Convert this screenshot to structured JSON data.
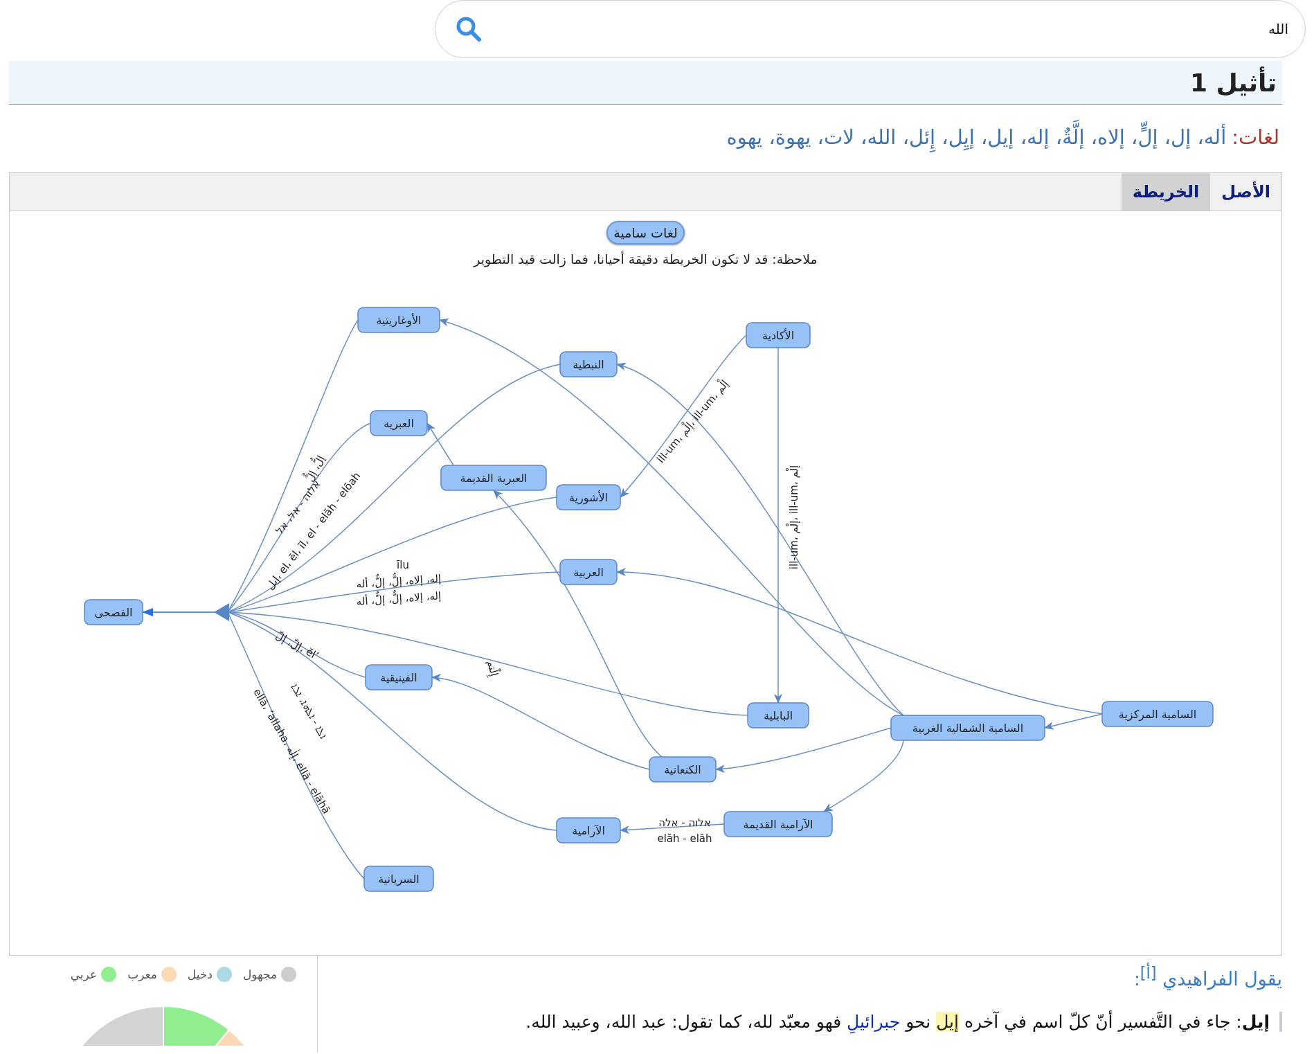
{
  "search": {
    "value": "الله"
  },
  "heading": "تأثيل 1",
  "languages_line": {
    "label": "لغات:",
    "value": "أله، إل، إلٍّ، إلاه، إلَّةٌ، إله، إيل، إيِل، إِئل، الله، لات، يهوة، يهوه"
  },
  "tabs": [
    {
      "label": "الأصل",
      "selected": false
    },
    {
      "label": "الخريطة",
      "selected": true
    }
  ],
  "map": {
    "title_button": "لغات سامية",
    "note": "ملاحظة: قد لا تكون الخريطة دقيقة أحيانا، فما زالت قيد التطوير",
    "nodes": [
      {
        "kind": "language",
        "label": "الفصحى"
      },
      {
        "kind": "language",
        "label": "الأوغاريتية"
      },
      {
        "kind": "language",
        "label": "العبرية"
      },
      {
        "kind": "language",
        "label": "العبرية القديمة"
      },
      {
        "kind": "language",
        "label": "النبطية"
      },
      {
        "kind": "language",
        "label": "الأشورية"
      },
      {
        "kind": "language",
        "label": "العربية"
      },
      {
        "kind": "language",
        "label": "الأكادية"
      },
      {
        "kind": "language",
        "label": "الفينيقية"
      },
      {
        "kind": "language",
        "label": "البابلية"
      },
      {
        "kind": "language",
        "label": "الكنعانية"
      },
      {
        "kind": "language",
        "label": "الآرامية"
      },
      {
        "kind": "language",
        "label": "الآرامية القديمة"
      },
      {
        "kind": "language",
        "label": "السامية الشمالية الغربية"
      },
      {
        "kind": "language",
        "label": "السامية المركزية"
      },
      {
        "kind": "language",
        "label": "السريانية"
      },
      {
        "kind": "junction"
      }
    ],
    "edge_labels": [
      {
        "lines": [
          "إلٌّ، إلٌّ"
        ]
      },
      {
        "lines": [
          "אלוה - אל، אל",
          "إيل، el، ēl، īl، el - elāh - elōah"
        ]
      },
      {
        "lines": [
          "īlu"
        ]
      },
      {
        "lines": [
          "إله، إلاه، إلٌّ، إلٌّ، أله",
          "إله، إلاه، إلٌّ، إلٌّ، أله"
        ]
      },
      {
        "lines": [
          "إِلْتم"
        ]
      },
      {
        "lines": [
          "إلّ، إلّ، ĕl’"
        ]
      },
      {
        "lines": [
          "ܐܠܐ - ܐܠܗܐ، ܐܠܐ",
          "ellā، ʼallaha، إلٰه، ellā - elāhā"
        ]
      },
      {
        "lines": [
          "ill-um، إلْم، ill-um، إلْم"
        ]
      },
      {
        "lines": [
          "ill-um، إلْم، ill-um، إلْم"
        ]
      },
      {
        "lines": [
          "אלוה - אלה",
          "elāh - elāh"
        ]
      }
    ]
  },
  "legend": [
    {
      "label": "مجهول",
      "color": "#cccccc"
    },
    {
      "label": "دخيل",
      "color": "#add8e6"
    },
    {
      "label": "معرب",
      "color": "#fcd9b4"
    },
    {
      "label": "عربي",
      "color": "#90ee90"
    }
  ],
  "quote": {
    "heading": "يقول الفراهيدي $^{[أ]}$:",
    "segments": [
      {
        "kind": "bold",
        "text": "إيل"
      },
      {
        "kind": "text",
        "text": ": جاء في التَّفسير أنّ كلّ اسم في آخره "
      },
      {
        "kind": "marked_link",
        "text": "إيل"
      },
      {
        "kind": "text",
        "text": " نحو "
      },
      {
        "kind": "link",
        "text": "جبرائيلِ"
      },
      {
        "kind": "text",
        "text": " فهو معبّد لله، كما تقول: عبد الله، وعبيد الله."
      }
    ]
  }
}
